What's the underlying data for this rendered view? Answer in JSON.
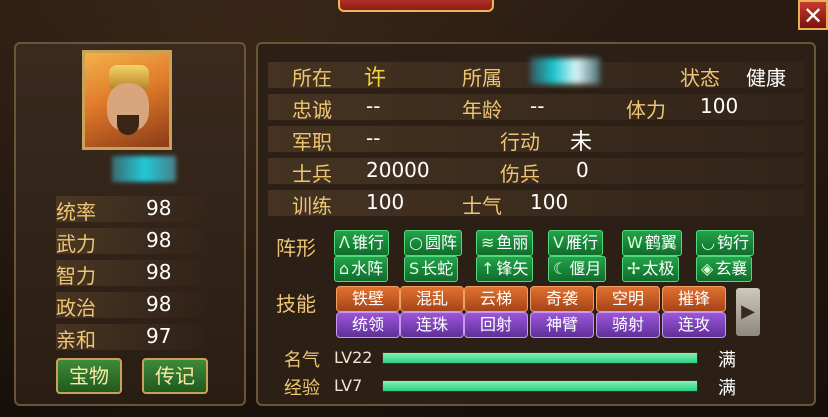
{
  "window": {
    "close_glyph": "✕"
  },
  "hero": {
    "attrs": [
      {
        "label": "统率",
        "value": "98"
      },
      {
        "label": "武力",
        "value": "98"
      },
      {
        "label": "智力",
        "value": "98"
      },
      {
        "label": "政治",
        "value": "98"
      },
      {
        "label": "亲和",
        "value": "97"
      }
    ],
    "buttons": {
      "treasure": "宝物",
      "biography": "传记"
    }
  },
  "info": {
    "location_label": "所在",
    "location_value": "许",
    "belong_label": "所属",
    "status_label": "状态",
    "status_value": "健康",
    "loyalty_label": "忠诚",
    "loyalty_value": "--",
    "age_label": "年龄",
    "age_value": "--",
    "stamina_label": "体力",
    "stamina_value": "100",
    "rank_label": "军职",
    "rank_value": "--",
    "action_label": "行动",
    "action_value": "未",
    "soldiers_label": "士兵",
    "soldiers_value": "20000",
    "wounded_label": "伤兵",
    "wounded_value": "0",
    "training_label": "训练",
    "training_value": "100",
    "morale_label": "士气",
    "morale_value": "100"
  },
  "formations": {
    "label": "阵形",
    "items": [
      {
        "icon": "ᐱ",
        "name": "锥行"
      },
      {
        "icon": "○",
        "name": "圆阵"
      },
      {
        "icon": "≋",
        "name": "鱼丽"
      },
      {
        "icon": "V",
        "name": "雁行"
      },
      {
        "icon": "W",
        "name": "鹤翼"
      },
      {
        "icon": "◡",
        "name": "钩行"
      },
      {
        "icon": "⌂",
        "name": "水阵"
      },
      {
        "icon": "S",
        "name": "长蛇"
      },
      {
        "icon": "↑",
        "name": "锋矢"
      },
      {
        "icon": "☾",
        "name": "偃月"
      },
      {
        "icon": "✢",
        "name": "太极"
      },
      {
        "icon": "◈",
        "name": "玄襄"
      }
    ]
  },
  "skills": {
    "label": "技能",
    "items": [
      {
        "name": "铁壁",
        "color": "orange"
      },
      {
        "name": "混乱",
        "color": "orange"
      },
      {
        "name": "云梯",
        "color": "orange"
      },
      {
        "name": "奇袭",
        "color": "orange"
      },
      {
        "name": "空明",
        "color": "orange"
      },
      {
        "name": "摧锋",
        "color": "orange"
      },
      {
        "name": "统领",
        "color": "purple"
      },
      {
        "name": "连珠",
        "color": "purple"
      },
      {
        "name": "回射",
        "color": "purple"
      },
      {
        "name": "神臂",
        "color": "purple"
      },
      {
        "name": "骑射",
        "color": "purple"
      },
      {
        "name": "连攻",
        "color": "purple"
      }
    ],
    "scroll_glyph": "▶"
  },
  "progress": {
    "fame": {
      "label": "名气",
      "level": "LV22",
      "max_text": "满",
      "fraction": 1.0
    },
    "exp": {
      "label": "经验",
      "level": "LV7",
      "max_text": "满",
      "fraction": 1.0
    }
  },
  "colors": {
    "accent": "#eec673",
    "formation_green": "#23a24a",
    "skill_orange": "#e0722e",
    "skill_purple": "#9b57d8"
  }
}
